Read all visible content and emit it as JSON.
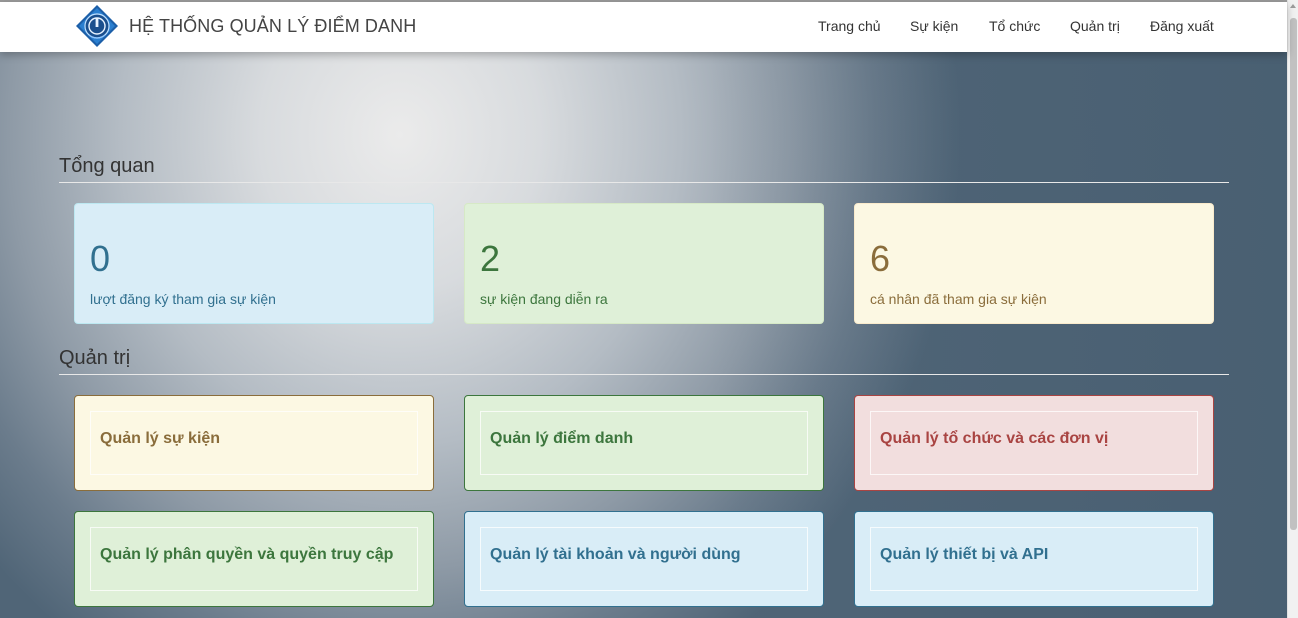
{
  "header": {
    "title": "HỆ THỐNG QUẢN LÝ ĐIỂM DANH",
    "logo_icon": "university-emblem-icon",
    "nav": [
      {
        "label": "Trang chủ"
      },
      {
        "label": "Sự kiện"
      },
      {
        "label": "Tổ chức"
      },
      {
        "label": "Quản trị"
      },
      {
        "label": "Đăng xuất"
      }
    ]
  },
  "overview": {
    "title": "Tổng quan",
    "stats": [
      {
        "value": "0",
        "label": "lượt đăng ký tham gia sự kiện",
        "style": "info"
      },
      {
        "value": "2",
        "label": "sự kiện đang diễn ra",
        "style": "success"
      },
      {
        "value": "6",
        "label": "cá nhân đã tham gia sự kiện",
        "style": "warning"
      }
    ]
  },
  "admin": {
    "title": "Quản trị",
    "cards": [
      {
        "label": "Quản lý sự kiện",
        "style": "warning"
      },
      {
        "label": "Quản lý điểm danh",
        "style": "success"
      },
      {
        "label": "Quản lý tổ chức và các đơn vị",
        "style": "danger"
      },
      {
        "label": "Quản lý phân quyền và quyền truy cập",
        "style": "success"
      },
      {
        "label": "Quản lý tài khoản và người dùng",
        "style": "info"
      },
      {
        "label": "Quản lý thiết bị và API",
        "style": "info"
      }
    ]
  },
  "colors": {
    "info_bg": "#d9edf7",
    "info_text": "#31708f",
    "success_bg": "#dff0d8",
    "success_text": "#3c763d",
    "warning_bg": "#fcf8e3",
    "warning_text": "#8a6d3b",
    "danger_bg": "#f2dede",
    "danger_text": "#a94442"
  }
}
